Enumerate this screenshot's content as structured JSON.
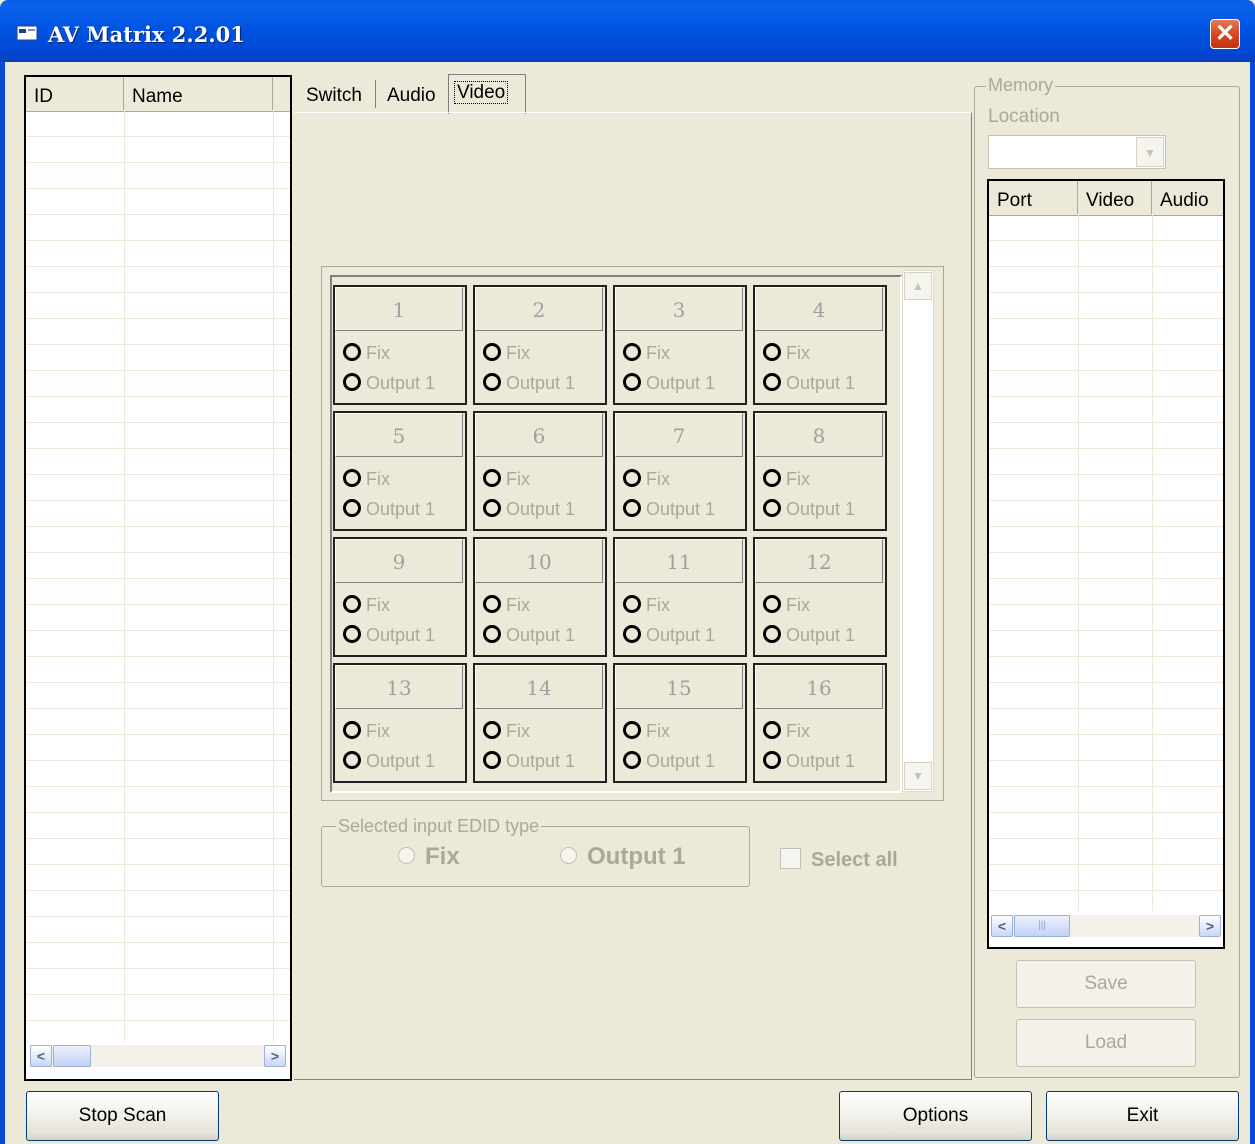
{
  "window": {
    "title": "AV Matrix 2.2.01",
    "close_glyph": "✕"
  },
  "left_list": {
    "columns": [
      "ID",
      "Name"
    ]
  },
  "tabs": [
    {
      "label": "Switch",
      "active": false
    },
    {
      "label": "Audio",
      "active": false
    },
    {
      "label": "Video",
      "active": true
    }
  ],
  "matrix": {
    "cells": [
      {
        "num": "1",
        "opt1": "Fix",
        "opt2": "Output 1"
      },
      {
        "num": "2",
        "opt1": "Fix",
        "opt2": "Output 1"
      },
      {
        "num": "3",
        "opt1": "Fix",
        "opt2": "Output 1"
      },
      {
        "num": "4",
        "opt1": "Fix",
        "opt2": "Output 1"
      },
      {
        "num": "5",
        "opt1": "Fix",
        "opt2": "Output 1"
      },
      {
        "num": "6",
        "opt1": "Fix",
        "opt2": "Output 1"
      },
      {
        "num": "7",
        "opt1": "Fix",
        "opt2": "Output 1"
      },
      {
        "num": "8",
        "opt1": "Fix",
        "opt2": "Output 1"
      },
      {
        "num": "9",
        "opt1": "Fix",
        "opt2": "Output 1"
      },
      {
        "num": "10",
        "opt1": "Fix",
        "opt2": "Output 1"
      },
      {
        "num": "11",
        "opt1": "Fix",
        "opt2": "Output 1"
      },
      {
        "num": "12",
        "opt1": "Fix",
        "opt2": "Output 1"
      },
      {
        "num": "13",
        "opt1": "Fix",
        "opt2": "Output 1"
      },
      {
        "num": "14",
        "opt1": "Fix",
        "opt2": "Output 1"
      },
      {
        "num": "15",
        "opt1": "Fix",
        "opt2": "Output 1"
      },
      {
        "num": "16",
        "opt1": "Fix",
        "opt2": "Output 1"
      }
    ]
  },
  "edid": {
    "legend": "Selected input EDID type",
    "fix_label": "Fix",
    "output_label": "Output 1",
    "select_all_label": "Select all"
  },
  "memory": {
    "legend": "Memory",
    "location_label": "Location",
    "location_value": "",
    "columns": [
      "Port",
      "Video",
      "Audio"
    ],
    "save_label": "Save",
    "load_label": "Load"
  },
  "footer": {
    "stop_scan": "Stop Scan",
    "options": "Options",
    "exit": "Exit"
  },
  "colors": {
    "window_bg": "#ece9d8",
    "titlebar_blue": "#0054e3",
    "close_red": "#d5451d",
    "disabled_text": "#aca899"
  }
}
